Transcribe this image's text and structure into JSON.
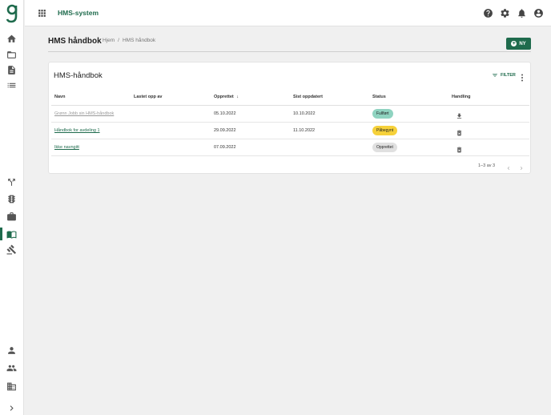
{
  "app": {
    "title": "HMS-system"
  },
  "colors": {
    "brand": "#1f6b4d",
    "done": "#8fd3c0",
    "progress": "#f6d13a",
    "created": "#e0e0e0"
  },
  "sidebar": {
    "logo": "g",
    "items": [
      {
        "icon": "home-icon"
      },
      {
        "icon": "folder-icon"
      },
      {
        "icon": "document-icon"
      },
      {
        "icon": "list-icon"
      },
      {
        "icon": "fork-icon"
      },
      {
        "icon": "traffic-light-icon"
      },
      {
        "icon": "briefcase-icon"
      },
      {
        "icon": "handbook-icon",
        "active": true
      },
      {
        "icon": "gavel-icon"
      },
      {
        "icon": "person-icon"
      },
      {
        "icon": "group-icon"
      },
      {
        "icon": "building-icon"
      },
      {
        "icon": "chevron-right-icon"
      }
    ]
  },
  "topbar": {
    "icons": [
      "apps-icon",
      "help-icon",
      "gear-icon",
      "bell-icon",
      "account-icon"
    ]
  },
  "page": {
    "title": "HMS håndbok",
    "breadcrumb": [
      "Hjem",
      "HMS håndbok"
    ],
    "new_button": "NY"
  },
  "card": {
    "title": "HMS-håndbok",
    "filter_label": "FILTER",
    "columns": [
      "Navn",
      "Lastet opp av",
      "Opprettet",
      "Sist oppdatert",
      "Status",
      "Handling"
    ],
    "rows": [
      {
        "name": "Grønn Jobb sin HMS-håndbok",
        "uploaded_by": "",
        "created": "05.10.2022",
        "updated": "10.10.2022",
        "status": "Fullført",
        "action": "download-icon"
      },
      {
        "name": "Håndbok for avdeling 1",
        "uploaded_by": "",
        "created": "29.09.2022",
        "updated": "11.10.2022",
        "status": "Påbegynt",
        "action": "trash-icon"
      },
      {
        "name": "Ikke navngitt",
        "uploaded_by": "",
        "created": "07.09.2022",
        "updated": "",
        "status": "Opprettet",
        "action": "trash-icon"
      }
    ],
    "pagination": "1–3 av 3"
  }
}
